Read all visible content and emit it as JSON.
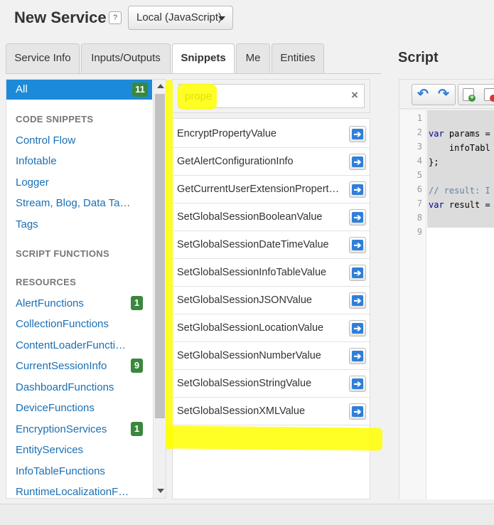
{
  "header": {
    "title": "New Service",
    "help_label": "?",
    "language": "Local (JavaScript)"
  },
  "tabs": [
    {
      "label": "Service Info"
    },
    {
      "label": "Inputs/Outputs"
    },
    {
      "label": "Snippets",
      "active": true
    },
    {
      "label": "Me"
    },
    {
      "label": "Entities"
    }
  ],
  "sidebar": {
    "all_label": "All",
    "all_count": "11",
    "code_snippets_heading": "CODE SNIPPETS",
    "code_snippets": [
      "Control Flow",
      "Infotable",
      "Logger",
      "Stream, Blog, Data Ta…",
      "Tags"
    ],
    "script_functions_heading": "SCRIPT FUNCTIONS",
    "resources_heading": "RESOURCES",
    "resources": [
      {
        "label": "AlertFunctions",
        "count": "1"
      },
      {
        "label": "CollectionFunctions",
        "count": ""
      },
      {
        "label": "ContentLoaderFuncti…",
        "count": ""
      },
      {
        "label": "CurrentSessionInfo",
        "count": "9"
      },
      {
        "label": "DashboardFunctions",
        "count": ""
      },
      {
        "label": "DeviceFunctions",
        "count": ""
      },
      {
        "label": "EncryptionServices",
        "count": "1"
      },
      {
        "label": "EntityServices",
        "count": ""
      },
      {
        "label": "InfoTableFunctions",
        "count": ""
      },
      {
        "label": "RuntimeLocalizationF…",
        "count": ""
      }
    ]
  },
  "search": {
    "value": "prope",
    "clear_icon": "×"
  },
  "results": [
    "EncryptPropertyValue",
    "GetAlertConfigurationInfo",
    "GetCurrentUserExtensionPropert…",
    "SetGlobalSessionBooleanValue",
    "SetGlobalSessionDateTimeValue",
    "SetGlobalSessionInfoTableValue",
    "SetGlobalSessionJSONValue",
    "SetGlobalSessionLocationValue",
    "SetGlobalSessionNumberValue",
    "SetGlobalSessionStringValue",
    "SetGlobalSessionXMLValue"
  ],
  "script": {
    "title": "Script",
    "line_numbers": [
      "1",
      "2",
      "3",
      "4",
      "5",
      "6",
      "7",
      "8",
      "9"
    ],
    "code": {
      "l2_kw": "var",
      "l2_rest": " params =",
      "l3": "    infoTabl",
      "l4": "};",
      "l6": "// result: I",
      "l7_kw": "var",
      "l7_rest": " result ="
    }
  },
  "colors": {
    "accent": "#1d8ad9",
    "badge": "#3b873e",
    "link": "#1a6fb5",
    "highlight": "#ffff00"
  }
}
